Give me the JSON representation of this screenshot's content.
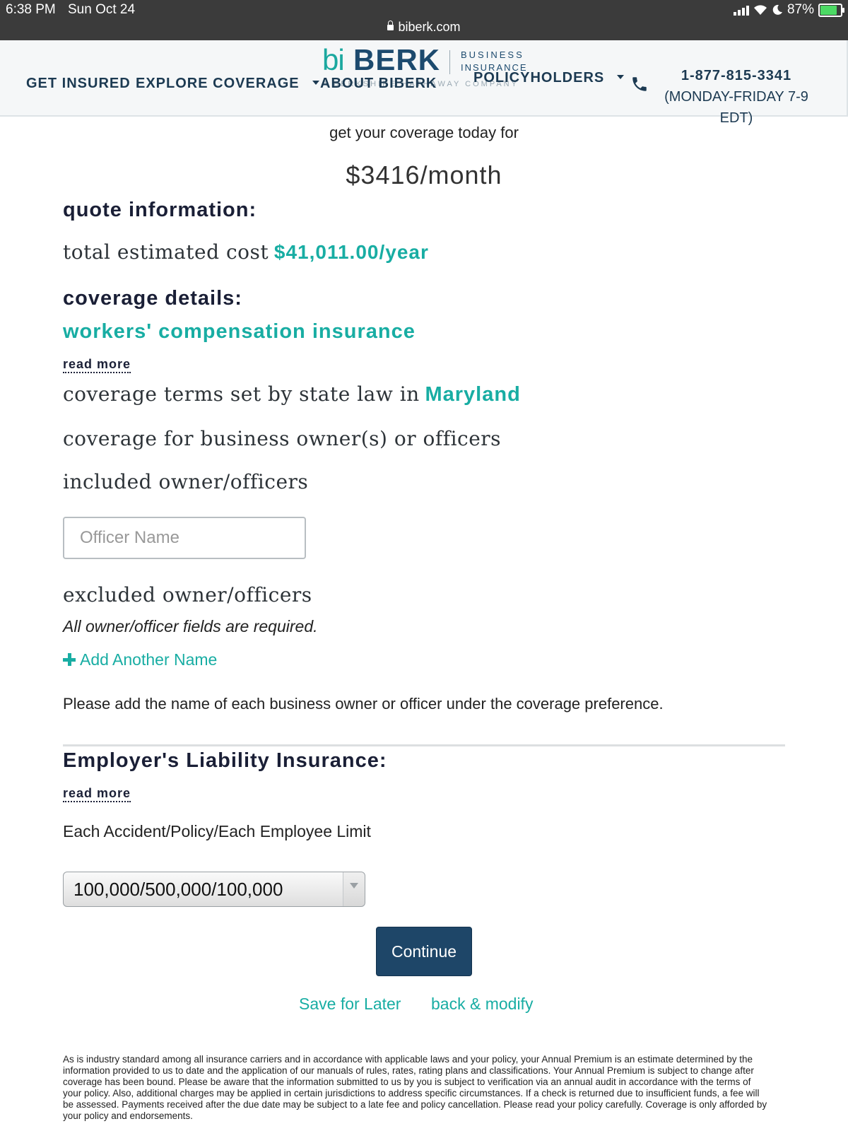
{
  "statusbar": {
    "time": "6:38 PM",
    "date": "Sun Oct 24",
    "battery": "87%",
    "battery_level": 0.87,
    "url": "biberk.com"
  },
  "nav": {
    "get_insured": "GET INSURED",
    "explore_coverage": "EXPLORE COVERAGE",
    "about": "ABOUT BIBERK",
    "policyholders": "POLICYHOLDERS",
    "logo_bi": "bi",
    "logo_berk": "BERK",
    "logo_business": "BUSINESS",
    "logo_insurance": "INSURANCE",
    "logo_tagline": "A BERKSHIRE HATHAWAY COMPANY",
    "phone_number": "1-877-815-3341",
    "phone_hours": "(MONDAY-FRIDAY 7-9 EDT)"
  },
  "quote": {
    "get_coverage": "get your coverage today for",
    "monthly_price": "$3416/month",
    "quote_info_heading": "quote information:",
    "total_label": "total estimated cost",
    "total_value": "$41,011.00/year",
    "coverage_details_heading": "coverage details:",
    "coverage_name": "workers' compensation insurance",
    "read_more": "read more",
    "state_law_label": "coverage terms set by state law in",
    "state": "Maryland",
    "owner_coverage": "coverage for business owner(s) or officers",
    "included_label": "included owner/officers",
    "officer_placeholder": "Officer Name",
    "excluded_label": "excluded owner/officers",
    "required_note": "All owner/officer fields are required.",
    "add_name": "Add Another Name",
    "please_add": "Please add the name of each business owner or officer under the coverage preference."
  },
  "employer": {
    "heading": "Employer's Liability Insurance:",
    "read_more": "read more",
    "limit_label": "Each Accident/Policy/Each Employee Limit",
    "limit_value": "100,000/500,000/100,000"
  },
  "actions": {
    "continue": "Continue",
    "save_later": "Save for Later",
    "back_modify": "back & modify"
  },
  "disclaimer": "As is industry standard among all insurance carriers and in accordance with applicable laws and your policy, your Annual Premium is an estimate determined by the information provided to us to date and the application of our manuals of rules, rates, rating plans and classifications. Your Annual Premium is subject to change after coverage has been bound. Please be aware that the information submitted to us by you is subject to verification via an annual audit in accordance with the terms of your policy. Also, additional charges may be applied in certain jurisdictions to address specific circumstances. If a check is returned due to insufficient funds, a fee will be assessed. Payments received after the due date may be subject to a late fee and policy cancellation. Please read your policy carefully. Coverage is only afforded by your policy and endorsements.",
  "colors": {
    "accent": "#18ada3",
    "navy": "#1e4668",
    "statusbar": "#3b3b3b"
  }
}
